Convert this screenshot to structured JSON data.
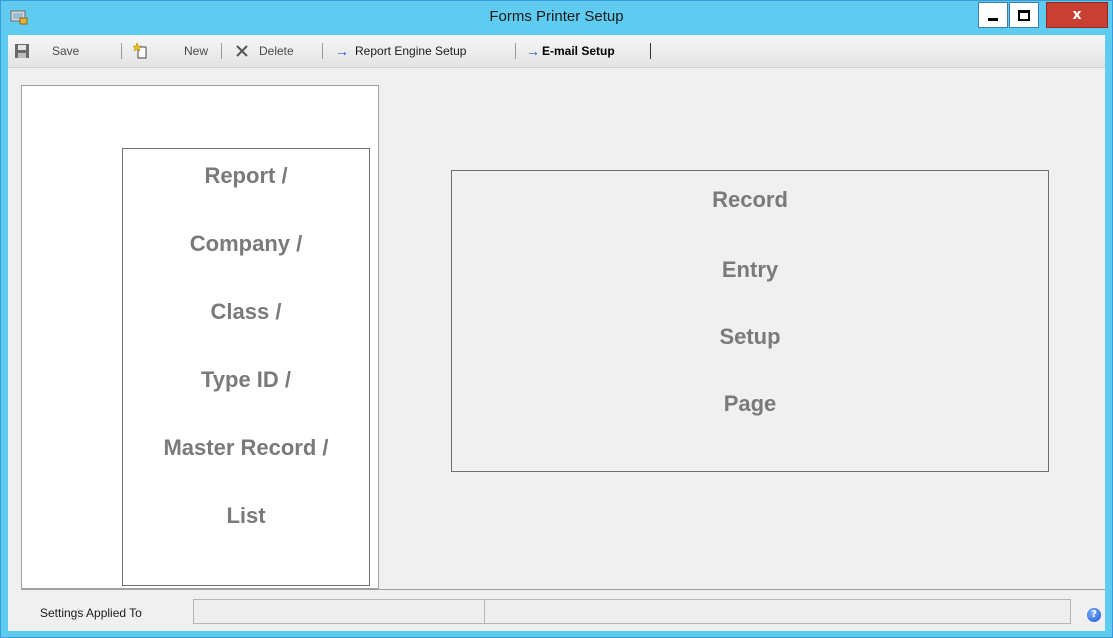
{
  "window": {
    "title": "Forms Printer Setup",
    "close_glyph": "x"
  },
  "toolbar": {
    "save_label": "Save",
    "new_label": "New",
    "delete_label": "Delete",
    "report_engine_label": "Report Engine Setup",
    "email_setup_label": "E-mail Setup",
    "arrow_glyph": "→"
  },
  "left_pane": {
    "lines": [
      "Report /",
      "Company /",
      "Class /",
      "Type ID /",
      "Master Record /",
      "List"
    ]
  },
  "right_pane": {
    "lines": [
      "Record",
      "Entry",
      "Setup",
      "Page"
    ]
  },
  "statusbar": {
    "label": "Settings Applied To",
    "field1_value": "",
    "field2_value": "",
    "help_glyph": "?"
  },
  "colors": {
    "titlebar": "#5fcbf0",
    "close_button": "#c84031",
    "accent_arrow": "#1a55d0",
    "placeholder_text": "#7a7a7a"
  }
}
